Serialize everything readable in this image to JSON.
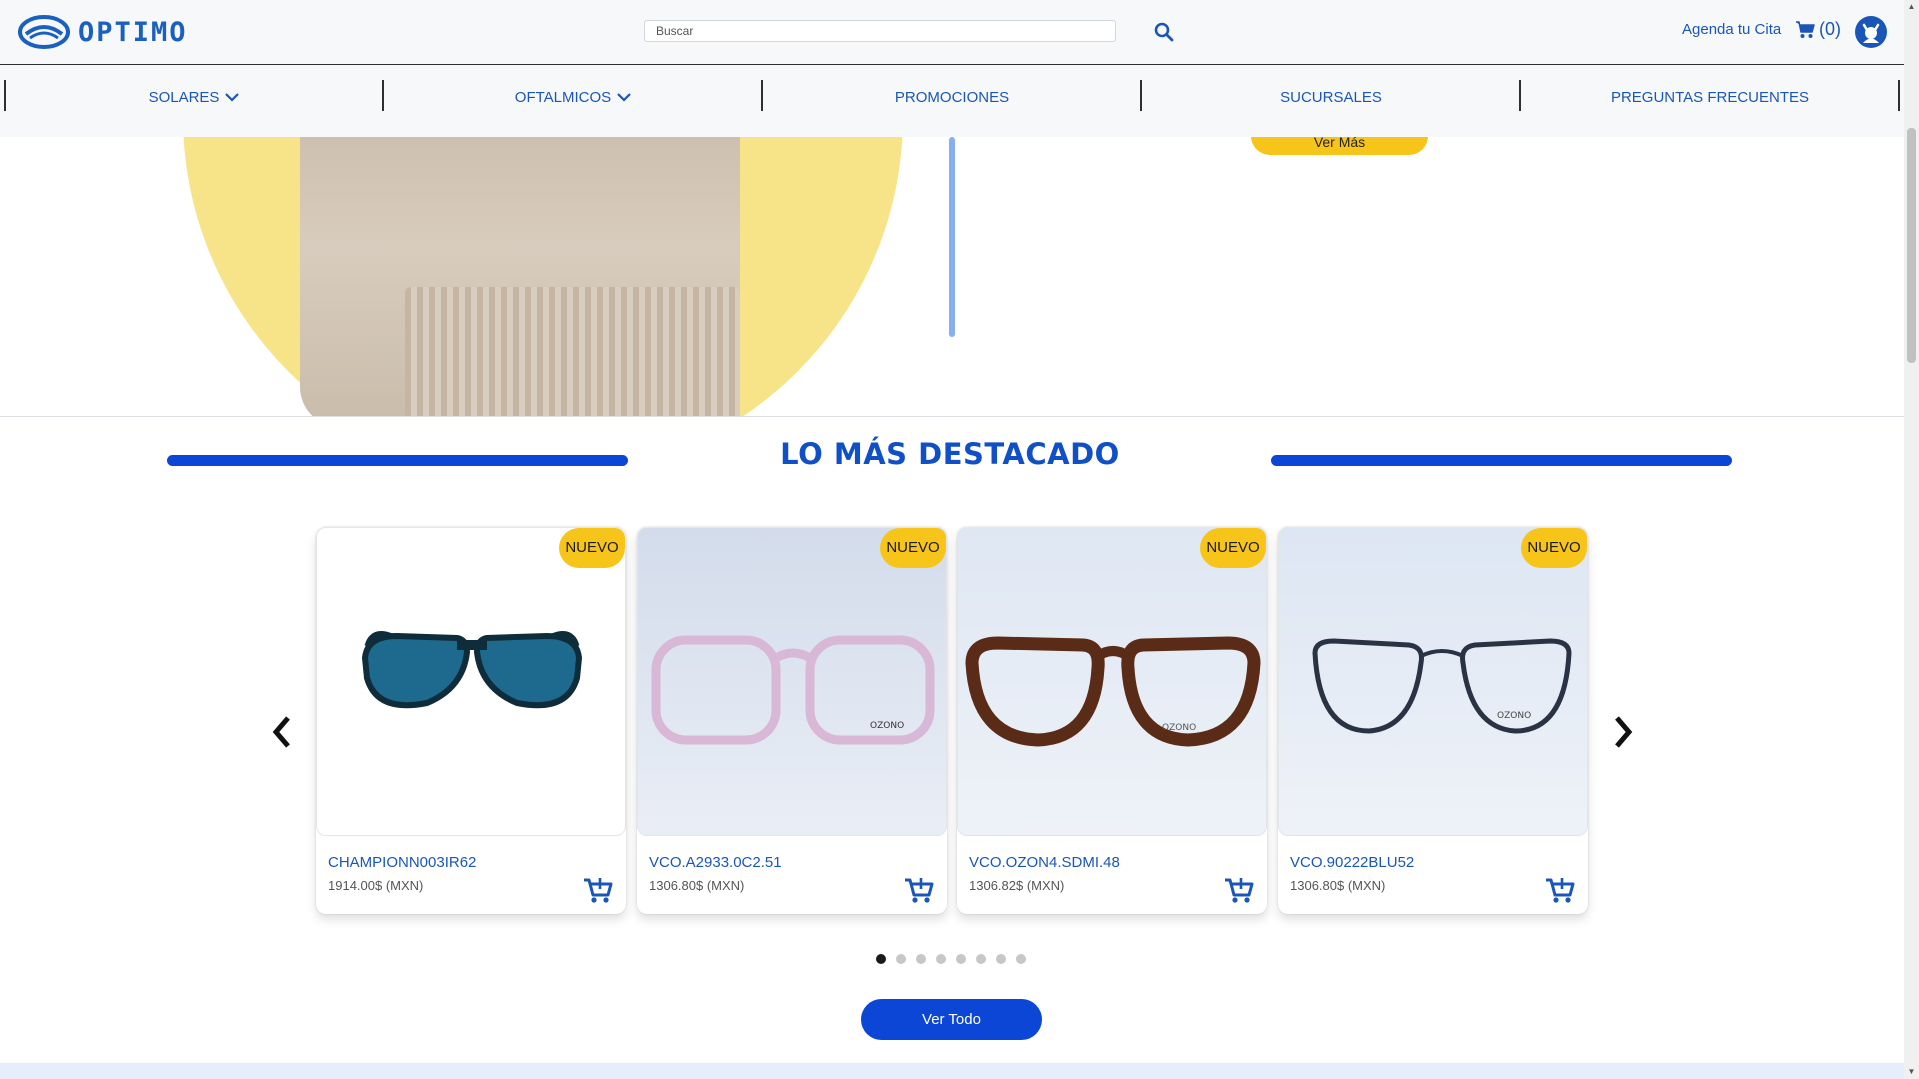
{
  "brand": {
    "name": "OPTIMO",
    "color": "#1b5fbf"
  },
  "search": {
    "placeholder": "Buscar",
    "value": ""
  },
  "header": {
    "agenda_label": "Agenda tu Cita",
    "cart_count": "(0)"
  },
  "nav": {
    "items": [
      {
        "label": "SOLARES",
        "has_dropdown": true
      },
      {
        "label": "OFTALMICOS",
        "has_dropdown": true
      },
      {
        "label": "PROMOCIONES",
        "has_dropdown": false
      },
      {
        "label": "SUCURSALES",
        "has_dropdown": false
      },
      {
        "label": "PREGUNTAS FRECUENTES",
        "has_dropdown": false
      }
    ]
  },
  "hero": {
    "button_label": "Ver Más"
  },
  "featured": {
    "title": "LO MÁS DESTACADO",
    "products": [
      {
        "badge": "NUEVO",
        "name": "CHAMPIONN003IR62",
        "price": "1914.00$ (MXN)"
      },
      {
        "badge": "NUEVO",
        "name": "VCO.A2933.0C2.51",
        "price": "1306.80$ (MXN)"
      },
      {
        "badge": "NUEVO",
        "name": "VCO.OZON4.SDMI.48",
        "price": "1306.82$ (MXN)"
      },
      {
        "badge": "NUEVO",
        "name": "VCO.90222BLU52",
        "price": "1306.80$ (MXN)"
      }
    ],
    "pagination": {
      "pages": 8,
      "active": 1
    },
    "view_all_label": "Ver Todo"
  },
  "colors": {
    "primary": "#0b46d6",
    "accent": "#f7c41a",
    "link": "#1a56b8"
  },
  "icons": [
    "eye-logo-icon",
    "search-icon",
    "cart-icon",
    "user-icon",
    "chevron-down-icon",
    "arrow-left-icon",
    "arrow-right-icon",
    "add-to-cart-icon"
  ]
}
